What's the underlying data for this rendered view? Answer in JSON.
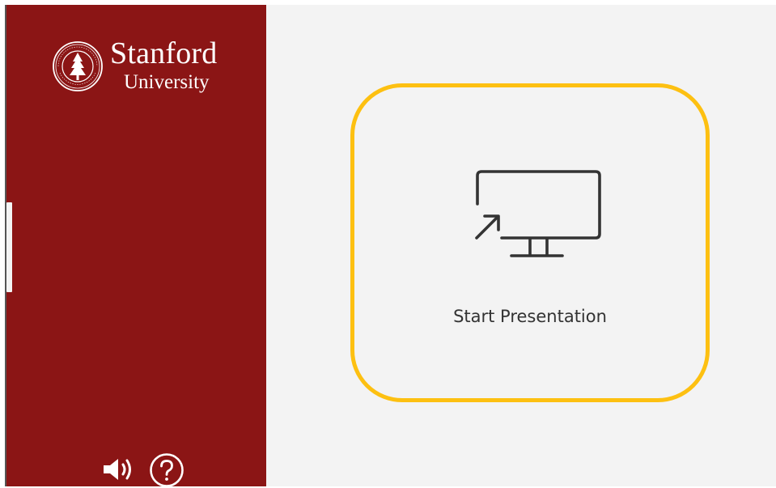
{
  "sidebar": {
    "logo": {
      "name": "Stanford",
      "subtitle": "University",
      "seal_icon": "stanford-seal"
    },
    "controls": [
      {
        "icon": "speaker-volume-icon"
      },
      {
        "icon": "help-question-icon"
      }
    ]
  },
  "main": {
    "start_button": {
      "label": "Start Presentation",
      "icon": "monitor-present-icon"
    }
  },
  "colors": {
    "sidebar_bg": "#8b1515",
    "main_bg": "#f3f3f3",
    "card_border": "#fdc011",
    "icon_stroke": "#333333"
  }
}
